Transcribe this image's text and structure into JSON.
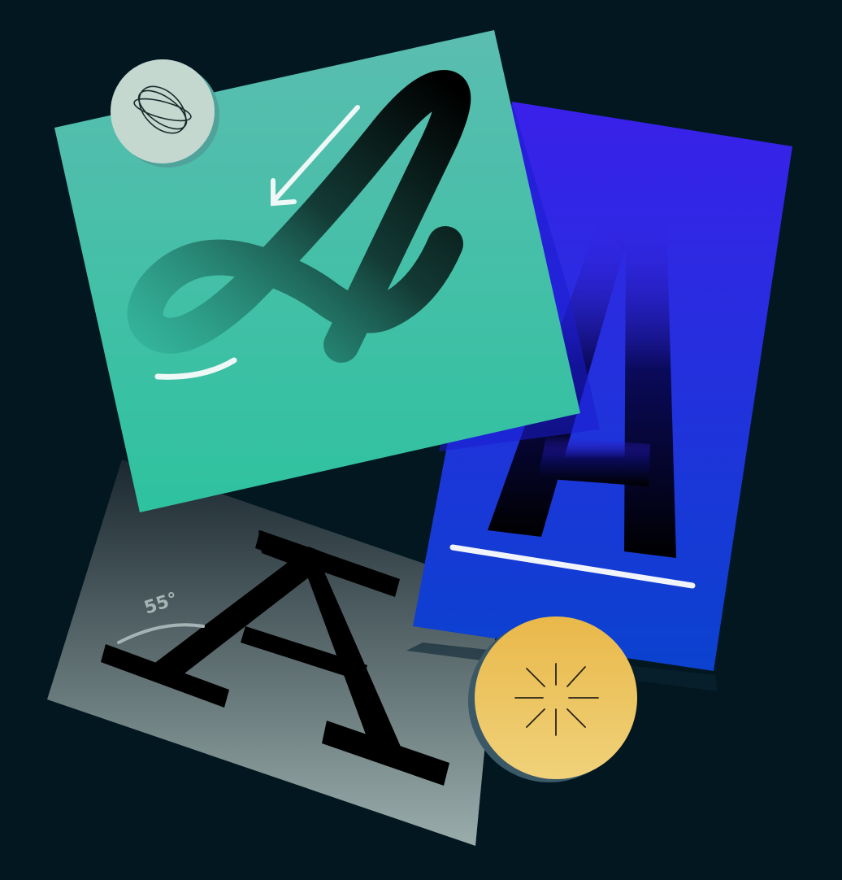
{
  "scene": {
    "background_color": "#021720",
    "cards": [
      {
        "name": "gray-serif-card",
        "glyph": "A",
        "glyph_style": "slab-serif",
        "gradient": [
          "#1b2830",
          "#9aadab"
        ],
        "annotation_text": "55°",
        "annotation_color": "#a6b4b6"
      },
      {
        "name": "blue-sans-card",
        "glyph": "A",
        "glyph_style": "condensed-sans",
        "gradient": [
          "#3a20ea",
          "#0b42cf"
        ],
        "underline_color": "#f1f4fb"
      },
      {
        "name": "green-script-card",
        "glyph": "A",
        "glyph_style": "script",
        "gradient": [
          "#5bbdb0",
          "#2ec29f"
        ],
        "arrow_color": "#eef8f6",
        "swash_color": "#eef8f6"
      }
    ],
    "badges": [
      {
        "name": "orbit-badge",
        "icon": "orbit-icon",
        "color": "#c4d8d0",
        "shadow": "#4fa39a"
      },
      {
        "name": "sparkle-badge",
        "icon": "sparkle-icon",
        "color": "#ebbf52",
        "shadow": "#3b5867"
      }
    ]
  }
}
